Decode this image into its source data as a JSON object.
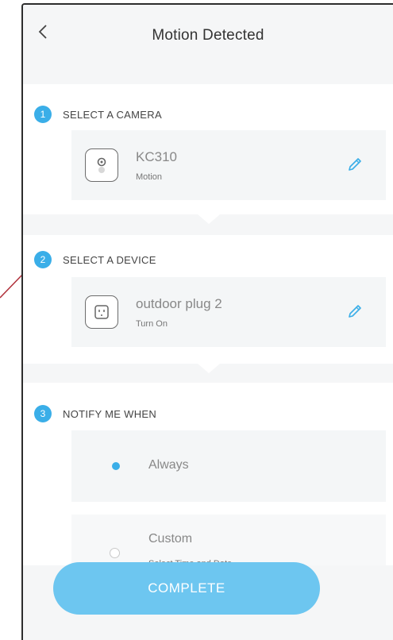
{
  "header": {
    "title": "Motion Detected"
  },
  "steps": [
    {
      "number": "1",
      "label": "SELECT A CAMERA",
      "device_name": "KC310",
      "device_status": "Motion"
    },
    {
      "number": "2",
      "label": "SELECT A DEVICE",
      "device_name": "outdoor plug 2",
      "device_status": "Turn On"
    },
    {
      "number": "3",
      "label": "NOTIFY ME WHEN"
    }
  ],
  "notify_options": [
    {
      "label": "Always",
      "selected": true
    },
    {
      "label": "Custom",
      "sublabel": "Select Time and Date",
      "selected": false
    }
  ],
  "complete_label": "COMPLETE",
  "colors": {
    "accent": "#3aaee8",
    "button": "#6dc6f0",
    "annotation_line": "#b0303a"
  },
  "icons": [
    "back-chevron-icon",
    "camera-icon",
    "edit-pencil-icon",
    "smart-plug-icon"
  ]
}
